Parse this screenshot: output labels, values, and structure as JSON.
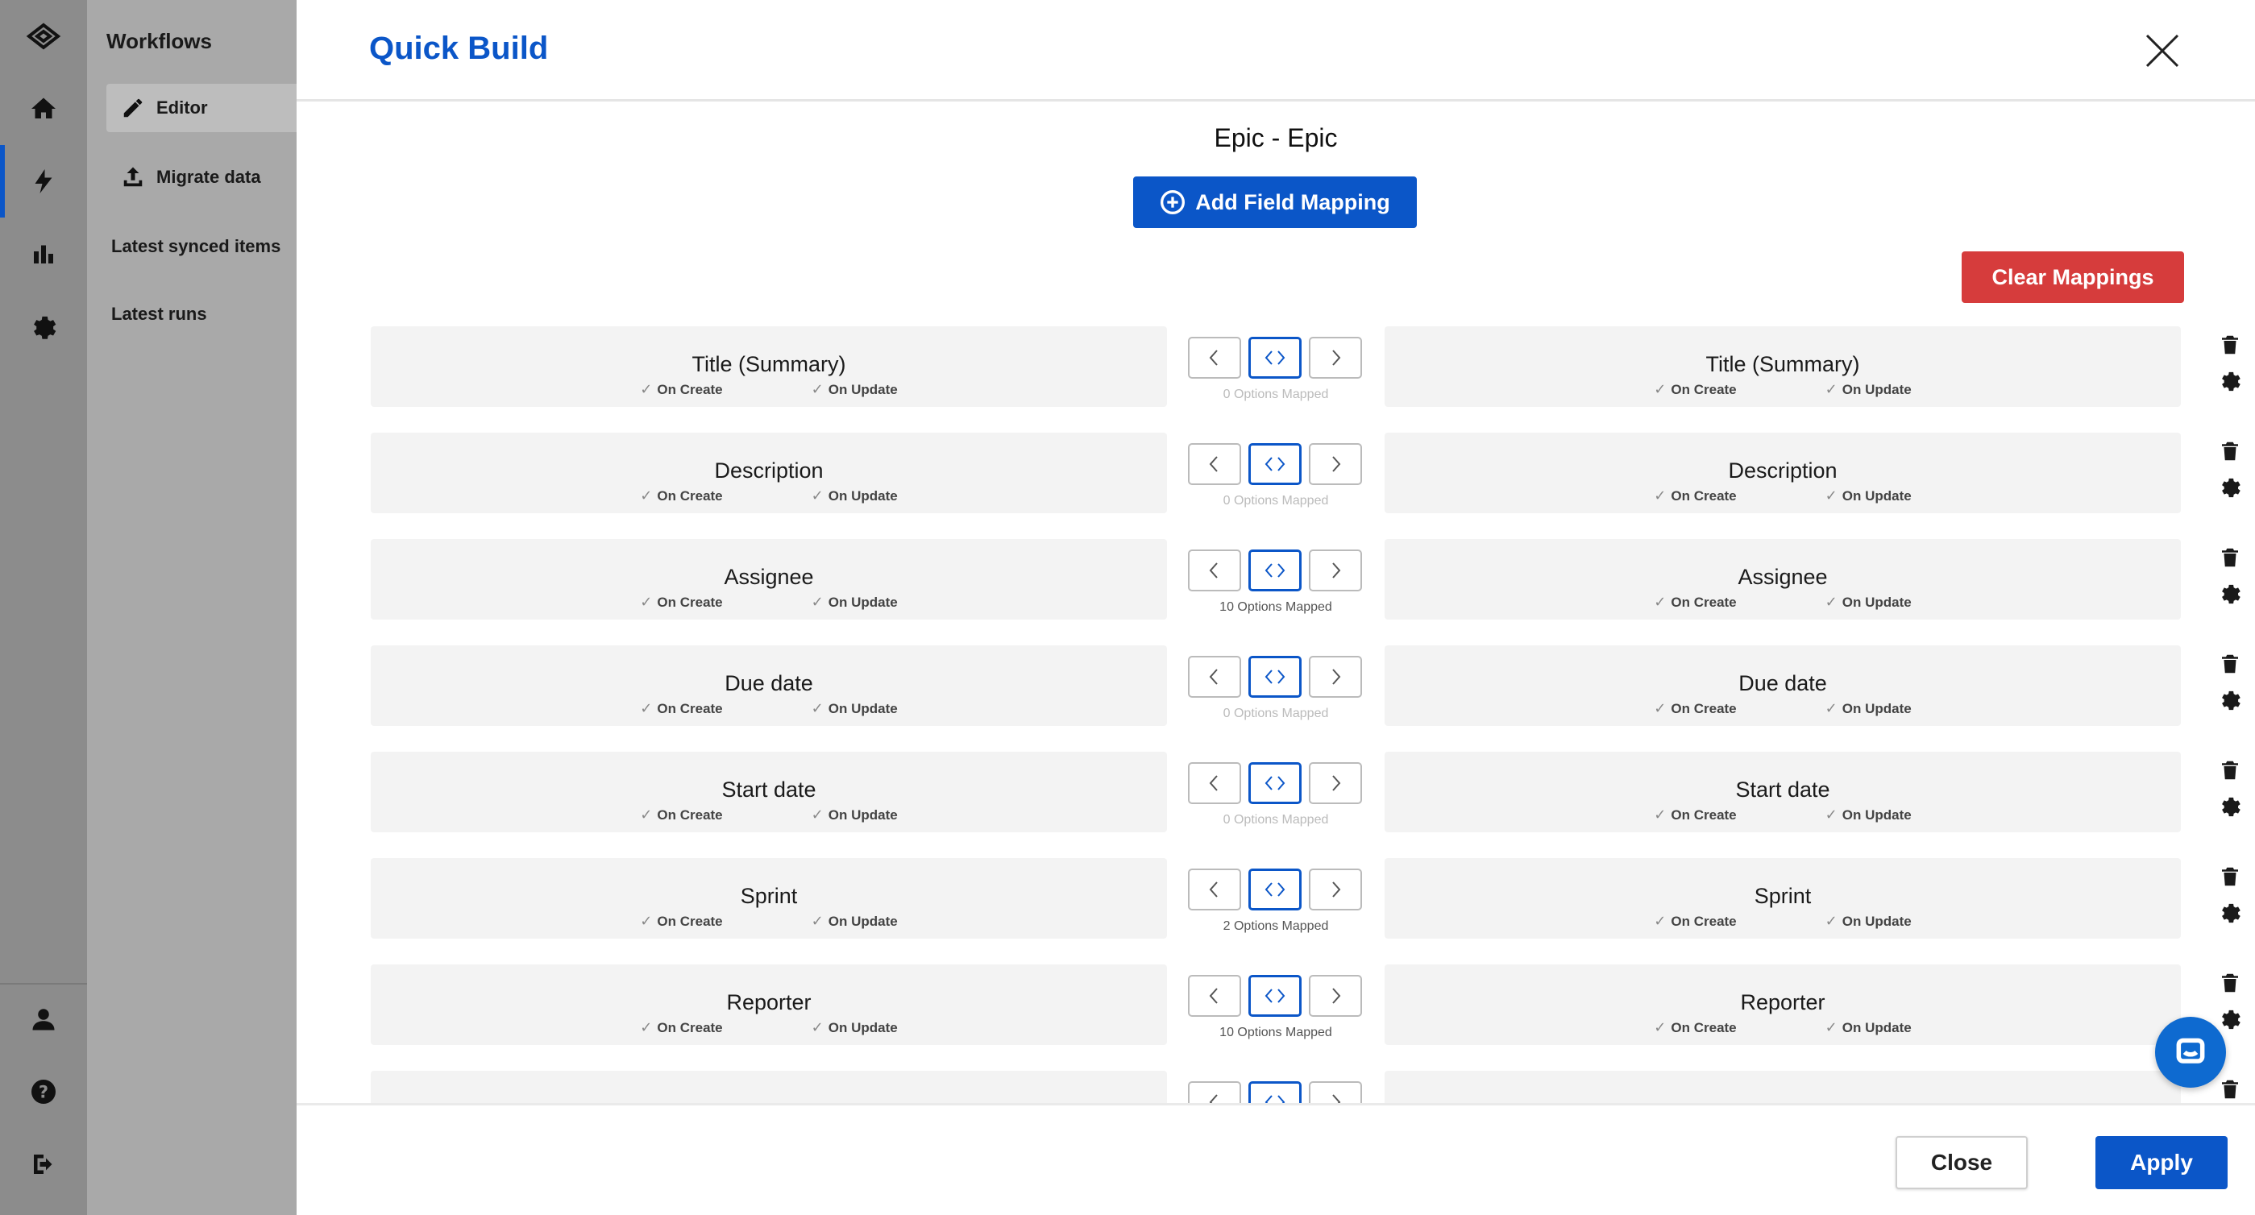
{
  "sidebar": {
    "title": "Workflows",
    "items": [
      {
        "label": "Editor",
        "active": true
      },
      {
        "label": "Migrate data",
        "active": false
      },
      {
        "label": "Latest synced items",
        "active": false
      },
      {
        "label": "Latest runs",
        "active": false
      }
    ]
  },
  "modal": {
    "title": "Quick Build",
    "type_title": "Epic - Epic",
    "add_button": "Add Field Mapping",
    "clear_button": "Clear Mappings",
    "flags": {
      "on_create": "On Create",
      "on_update": "On Update"
    },
    "rows": [
      {
        "left": "Title (Summary)",
        "right": "Title (Summary)",
        "options": "0 Options Mapped"
      },
      {
        "left": "Description",
        "right": "Description",
        "options": "0 Options Mapped"
      },
      {
        "left": "Assignee",
        "right": "Assignee",
        "options": "10 Options Mapped"
      },
      {
        "left": "Due date",
        "right": "Due date",
        "options": "0 Options Mapped"
      },
      {
        "left": "Start date",
        "right": "Start date",
        "options": "0 Options Mapped"
      },
      {
        "left": "Sprint",
        "right": "Sprint",
        "options": "2 Options Mapped"
      },
      {
        "left": "Reporter",
        "right": "Reporter",
        "options": "10 Options Mapped"
      },
      {
        "left": "",
        "right": "",
        "options": ""
      }
    ],
    "close_button": "Close",
    "apply_button": "Apply"
  },
  "colors": {
    "accent": "#0b56c8",
    "danger": "#d63c3c"
  }
}
